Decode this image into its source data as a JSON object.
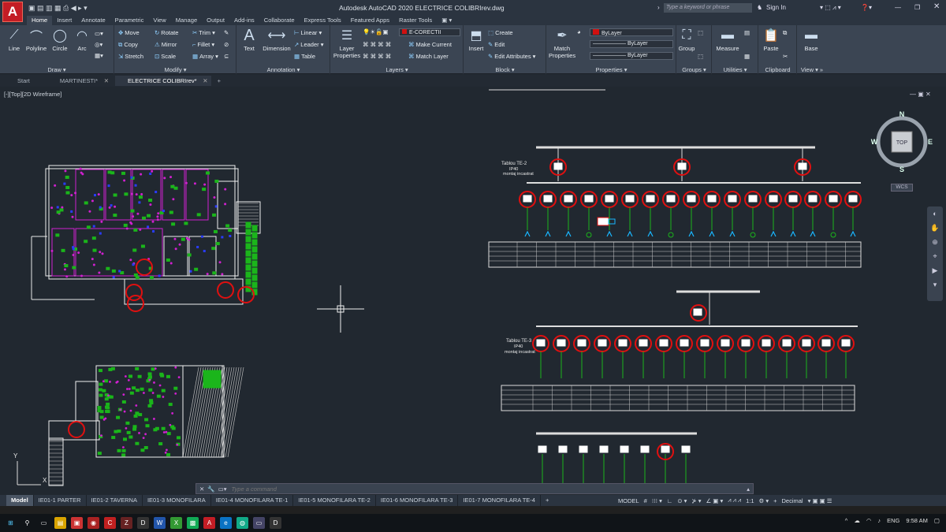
{
  "app": {
    "logo": "A",
    "title": "Autodesk AutoCAD 2020   ELECTRICE COLIBRIrev.dwg",
    "search_placeholder": "Type a keyword or phrase",
    "sign_in": "Sign In"
  },
  "ribbon_tabs": [
    "Home",
    "Insert",
    "Annotate",
    "Parametric",
    "View",
    "Manage",
    "Output",
    "Add-ins",
    "Collaborate",
    "Express Tools",
    "Featured Apps",
    "Raster Tools"
  ],
  "ribbon": {
    "draw": {
      "title": "Draw",
      "tools": [
        "Line",
        "Polyline",
        "Circle",
        "Arc"
      ]
    },
    "modify": {
      "title": "Modify",
      "tools": [
        "Move",
        "Rotate",
        "Trim",
        "Copy",
        "Mirror",
        "Fillet",
        "Stretch",
        "Scale",
        "Array"
      ]
    },
    "annotation": {
      "title": "Annotation",
      "text": "Text",
      "dimension": "Dimension",
      "linear": "Linear",
      "leader": "Leader",
      "table": "Table"
    },
    "layers": {
      "title": "Layers",
      "layer_properties": "Layer Properties",
      "current_layer": "E-CORECTII",
      "make_current": "Make Current",
      "match_layer": "Match Layer"
    },
    "block": {
      "title": "Block",
      "insert": "Insert",
      "create": "Create",
      "edit": "Edit",
      "edit_attributes": "Edit Attributes"
    },
    "properties": {
      "title": "Properties",
      "match": "Match Properties",
      "color": "ByLayer",
      "linetype": "ByLayer",
      "lineweight": "ByLayer"
    },
    "groups": {
      "title": "Groups",
      "group": "Group"
    },
    "utilities": {
      "title": "Utilities",
      "measure": "Measure"
    },
    "clipboard": {
      "title": "Clipboard",
      "paste": "Paste"
    },
    "view": {
      "title": "View",
      "base": "Base"
    }
  },
  "doc_tabs": [
    {
      "label": "Start"
    },
    {
      "label": "MARTINESTI*"
    },
    {
      "label": "ELECTRICE COLIBRIrev*"
    }
  ],
  "viewport_label": "[-][Top][2D Wireframe]",
  "viewcube": {
    "n": "N",
    "s": "S",
    "e": "E",
    "w": "W",
    "top": "TOP",
    "wcs": "WCS"
  },
  "drawing": {
    "te2_title": "Tablou TE-2",
    "te2_ip": "IP40",
    "te2_mount": "montaj incastrat",
    "te3_title": "Tablou TE-3",
    "te3_ip": "IP40",
    "te3_mount": "montaj incastrat"
  },
  "command": {
    "placeholder": "Type a command"
  },
  "layout_tabs": [
    "Model",
    "IE01-1 PARTER",
    "IE01-2 TAVERNA",
    "IE01-3 MONOFILARA",
    "IE01-4 MONOFILARA TE-1",
    "IE01-5 MONOFILARA TE-2",
    "IE01-6 MONOFILARA TE-3",
    "IE01-7 MONOFILARA TE-4"
  ],
  "status": {
    "model": "MODEL",
    "scale": "1:1",
    "units": "Decimal"
  },
  "taskbar": {
    "lang": "ENG",
    "time": "9:58 AM"
  },
  "colors": {
    "accent": "#c31d25",
    "circle": "#e01010",
    "green": "#1bb51b",
    "magenta": "#d020d0",
    "blue": "#2a3cff",
    "cyan": "#19b7ff"
  }
}
